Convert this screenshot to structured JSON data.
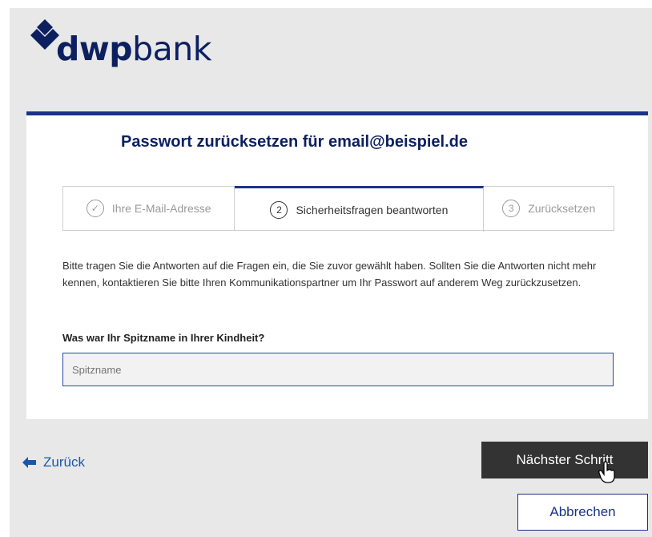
{
  "brand": {
    "name_bold": "dwp",
    "name_light": "bank",
    "logo_icon": "diamond-chevron-icon",
    "color": "#0c2060"
  },
  "card": {
    "title": "Passwort zurücksetzen für email@beispiel.de",
    "accent_color": "#1a3388"
  },
  "steps": [
    {
      "number": "✓",
      "label": "Ihre E-Mail-Adresse",
      "state": "completed"
    },
    {
      "number": "2",
      "label": "Sicherheitsfragen beantworten",
      "state": "active"
    },
    {
      "number": "3",
      "label": "Zurücksetzen",
      "state": "upcoming"
    }
  ],
  "instructions": "Bitte tragen Sie die Antworten auf die Fragen ein, die Sie zuvor gewählt haben. Sollten Sie die Antworten nicht mehr kennen, kontaktieren Sie bitte Ihren Kommunikationspartner um Ihr Passwort auf anderem Weg zurückzusetzen.",
  "question": {
    "label": "Was war Ihr Spitzname in Ihrer Kindheit?",
    "placeholder": "Spitzname",
    "value": ""
  },
  "footer": {
    "back_label": "Zurück",
    "next_label": "Nächster Schritt",
    "cancel_label": "Abbrechen"
  }
}
